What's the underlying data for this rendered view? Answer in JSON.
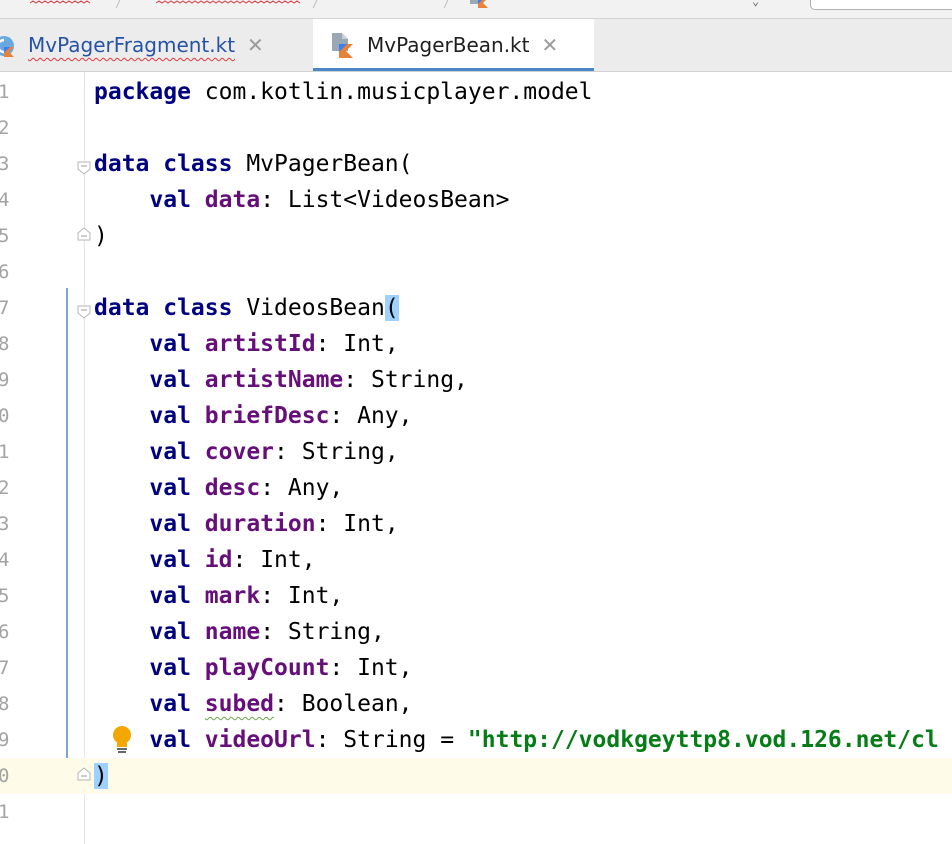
{
  "tabs": [
    {
      "label": "MvPagerFragment.kt",
      "close_icon": "close-icon",
      "icon": "kotlin-class-icon"
    },
    {
      "label": "MvPagerBean.kt",
      "close_icon": "close-icon",
      "icon": "kotlin-file-icon",
      "active": true
    }
  ],
  "editor": {
    "lines": [
      {
        "num": "1",
        "segments": [
          {
            "t": "package",
            "c": "kw"
          },
          {
            "t": " com.kotlin.musicplayer.model"
          }
        ]
      },
      {
        "num": "2",
        "segments": []
      },
      {
        "num": "3",
        "fold": "open",
        "segments": [
          {
            "t": "data class",
            "c": "kw"
          },
          {
            "t": " MvPagerBean("
          }
        ]
      },
      {
        "num": "4",
        "segments": [
          {
            "t": "    "
          },
          {
            "t": "val",
            "c": "kw"
          },
          {
            "t": " "
          },
          {
            "t": "data",
            "c": "prop"
          },
          {
            "t": ": List<VideosBean>"
          }
        ]
      },
      {
        "num": "5",
        "fold": "close",
        "segments": [
          {
            "t": ")"
          }
        ]
      },
      {
        "num": "6",
        "segments": []
      },
      {
        "num": "7",
        "fold": "open",
        "segments": [
          {
            "t": "data class",
            "c": "kw"
          },
          {
            "t": " VideosBean"
          },
          {
            "t": "(",
            "c": "brace-hl"
          }
        ]
      },
      {
        "num": "8",
        "segments": [
          {
            "t": "    "
          },
          {
            "t": "val",
            "c": "kw"
          },
          {
            "t": " "
          },
          {
            "t": "artistId",
            "c": "prop"
          },
          {
            "t": ": Int,"
          }
        ]
      },
      {
        "num": "9",
        "segments": [
          {
            "t": "    "
          },
          {
            "t": "val",
            "c": "kw"
          },
          {
            "t": " "
          },
          {
            "t": "artistName",
            "c": "prop"
          },
          {
            "t": ": String,"
          }
        ]
      },
      {
        "num": "0",
        "segments": [
          {
            "t": "    "
          },
          {
            "t": "val",
            "c": "kw"
          },
          {
            "t": " "
          },
          {
            "t": "briefDesc",
            "c": "prop"
          },
          {
            "t": ": Any,"
          }
        ]
      },
      {
        "num": "1",
        "segments": [
          {
            "t": "    "
          },
          {
            "t": "val",
            "c": "kw"
          },
          {
            "t": " "
          },
          {
            "t": "cover",
            "c": "prop"
          },
          {
            "t": ": String,"
          }
        ]
      },
      {
        "num": "2",
        "segments": [
          {
            "t": "    "
          },
          {
            "t": "val",
            "c": "kw"
          },
          {
            "t": " "
          },
          {
            "t": "desc",
            "c": "prop"
          },
          {
            "t": ": Any,"
          }
        ]
      },
      {
        "num": "3",
        "segments": [
          {
            "t": "    "
          },
          {
            "t": "val",
            "c": "kw"
          },
          {
            "t": " "
          },
          {
            "t": "duration",
            "c": "prop"
          },
          {
            "t": ": Int,"
          }
        ]
      },
      {
        "num": "4",
        "segments": [
          {
            "t": "    "
          },
          {
            "t": "val",
            "c": "kw"
          },
          {
            "t": " "
          },
          {
            "t": "id",
            "c": "prop"
          },
          {
            "t": ": Int,"
          }
        ]
      },
      {
        "num": "5",
        "segments": [
          {
            "t": "    "
          },
          {
            "t": "val",
            "c": "kw"
          },
          {
            "t": " "
          },
          {
            "t": "mark",
            "c": "prop"
          },
          {
            "t": ": Int,"
          }
        ]
      },
      {
        "num": "6",
        "segments": [
          {
            "t": "    "
          },
          {
            "t": "val",
            "c": "kw"
          },
          {
            "t": " "
          },
          {
            "t": "name",
            "c": "prop"
          },
          {
            "t": ": String,"
          }
        ]
      },
      {
        "num": "7",
        "segments": [
          {
            "t": "    "
          },
          {
            "t": "val",
            "c": "kw"
          },
          {
            "t": " "
          },
          {
            "t": "playCount",
            "c": "prop"
          },
          {
            "t": ": Int,"
          }
        ]
      },
      {
        "num": "8",
        "segments": [
          {
            "t": "    "
          },
          {
            "t": "val",
            "c": "kw"
          },
          {
            "t": " "
          },
          {
            "t": "subed",
            "c": "prop warn-ul"
          },
          {
            "t": ": Boolean,"
          }
        ]
      },
      {
        "num": "9",
        "bulb": "lightbulb-icon",
        "segments": [
          {
            "t": "    "
          },
          {
            "t": "val",
            "c": "kw"
          },
          {
            "t": " "
          },
          {
            "t": "videoUrl",
            "c": "prop"
          },
          {
            "t": ": String = "
          },
          {
            "t": "\"http://vodkgeyttp8.vod.126.net/cl",
            "c": "str"
          }
        ]
      },
      {
        "num": "0",
        "fold": "close",
        "caret": true,
        "segments": [
          {
            "t": ")",
            "c": "brace-hl"
          }
        ]
      },
      {
        "num": "1",
        "segments": []
      }
    ]
  },
  "colors": {
    "keyword": "#000080",
    "property": "#660e7a",
    "string": "#067d17",
    "brace_highlight": "#9fd1ff",
    "caret_line": "#fefce9",
    "tab_underline": "#4a88c7"
  }
}
